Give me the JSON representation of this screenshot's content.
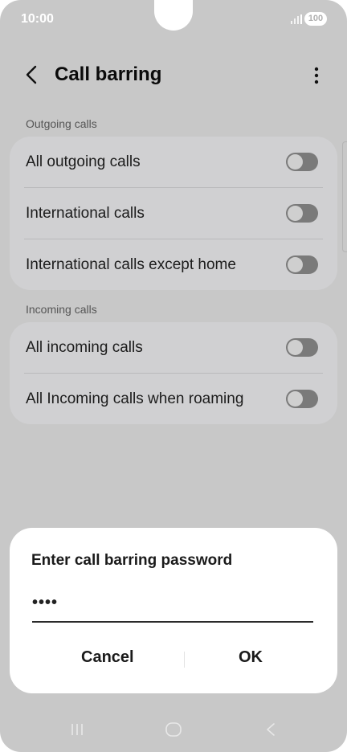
{
  "status": {
    "time": "10:00",
    "battery": "100"
  },
  "header": {
    "title": "Call barring"
  },
  "outgoing": {
    "heading": "Outgoing calls",
    "items": [
      {
        "label": "All outgoing calls",
        "enabled": false
      },
      {
        "label": "International calls",
        "enabled": false
      },
      {
        "label": "International calls except home",
        "enabled": false
      }
    ]
  },
  "incoming": {
    "heading": "Incoming calls",
    "items": [
      {
        "label": "All incoming calls",
        "enabled": false
      },
      {
        "label": "All Incoming calls when roaming",
        "enabled": false
      }
    ]
  },
  "dialog": {
    "title": "Enter call barring password",
    "password_value": "••••",
    "cancel_label": "Cancel",
    "ok_label": "OK"
  },
  "icons": [
    "back-arrow-icon",
    "more-options-icon",
    "signal-icon",
    "recent-apps-icon",
    "home-icon",
    "back-icon"
  ],
  "colors": {
    "scrim": "#c8c8c8",
    "card": "#d0d0d2",
    "dialog": "#ffffff",
    "toggle_off": "#7a7a7a"
  }
}
